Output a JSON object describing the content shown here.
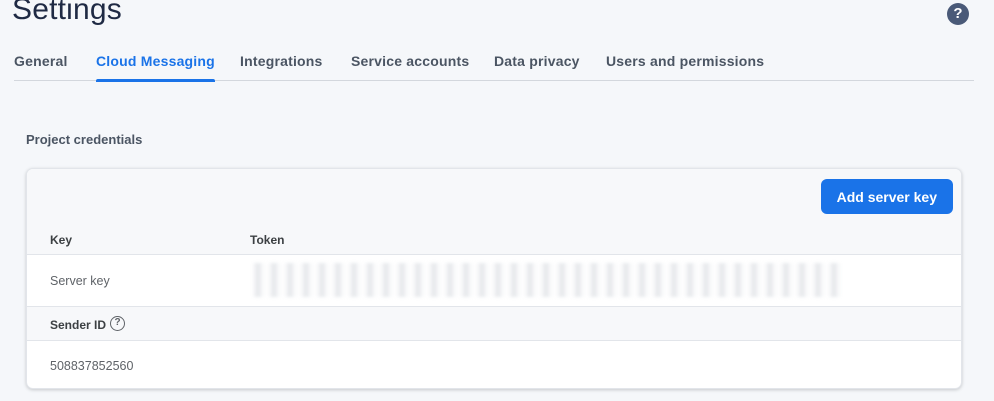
{
  "header": {
    "title": "Settings",
    "help_icon": "help-circle-icon",
    "help_glyph": "?"
  },
  "tabs": [
    {
      "label": "General",
      "active": false
    },
    {
      "label": "Cloud Messaging",
      "active": true
    },
    {
      "label": "Integrations",
      "active": false
    },
    {
      "label": "Service accounts",
      "active": false
    },
    {
      "label": "Data privacy",
      "active": false
    },
    {
      "label": "Users and permissions",
      "active": false
    }
  ],
  "section": {
    "title": "Project credentials"
  },
  "credentials": {
    "add_button_label": "Add server key",
    "columns": {
      "key": "Key",
      "token": "Token"
    },
    "rows": [
      {
        "key": "Server key",
        "token": "[redacted]"
      }
    ],
    "sender": {
      "label": "Sender ID",
      "info_icon": "info-circle-icon",
      "info_glyph": "?",
      "value": "508837852560"
    }
  },
  "colors": {
    "accent": "#1a73e8",
    "background": "#f5f7fa"
  }
}
